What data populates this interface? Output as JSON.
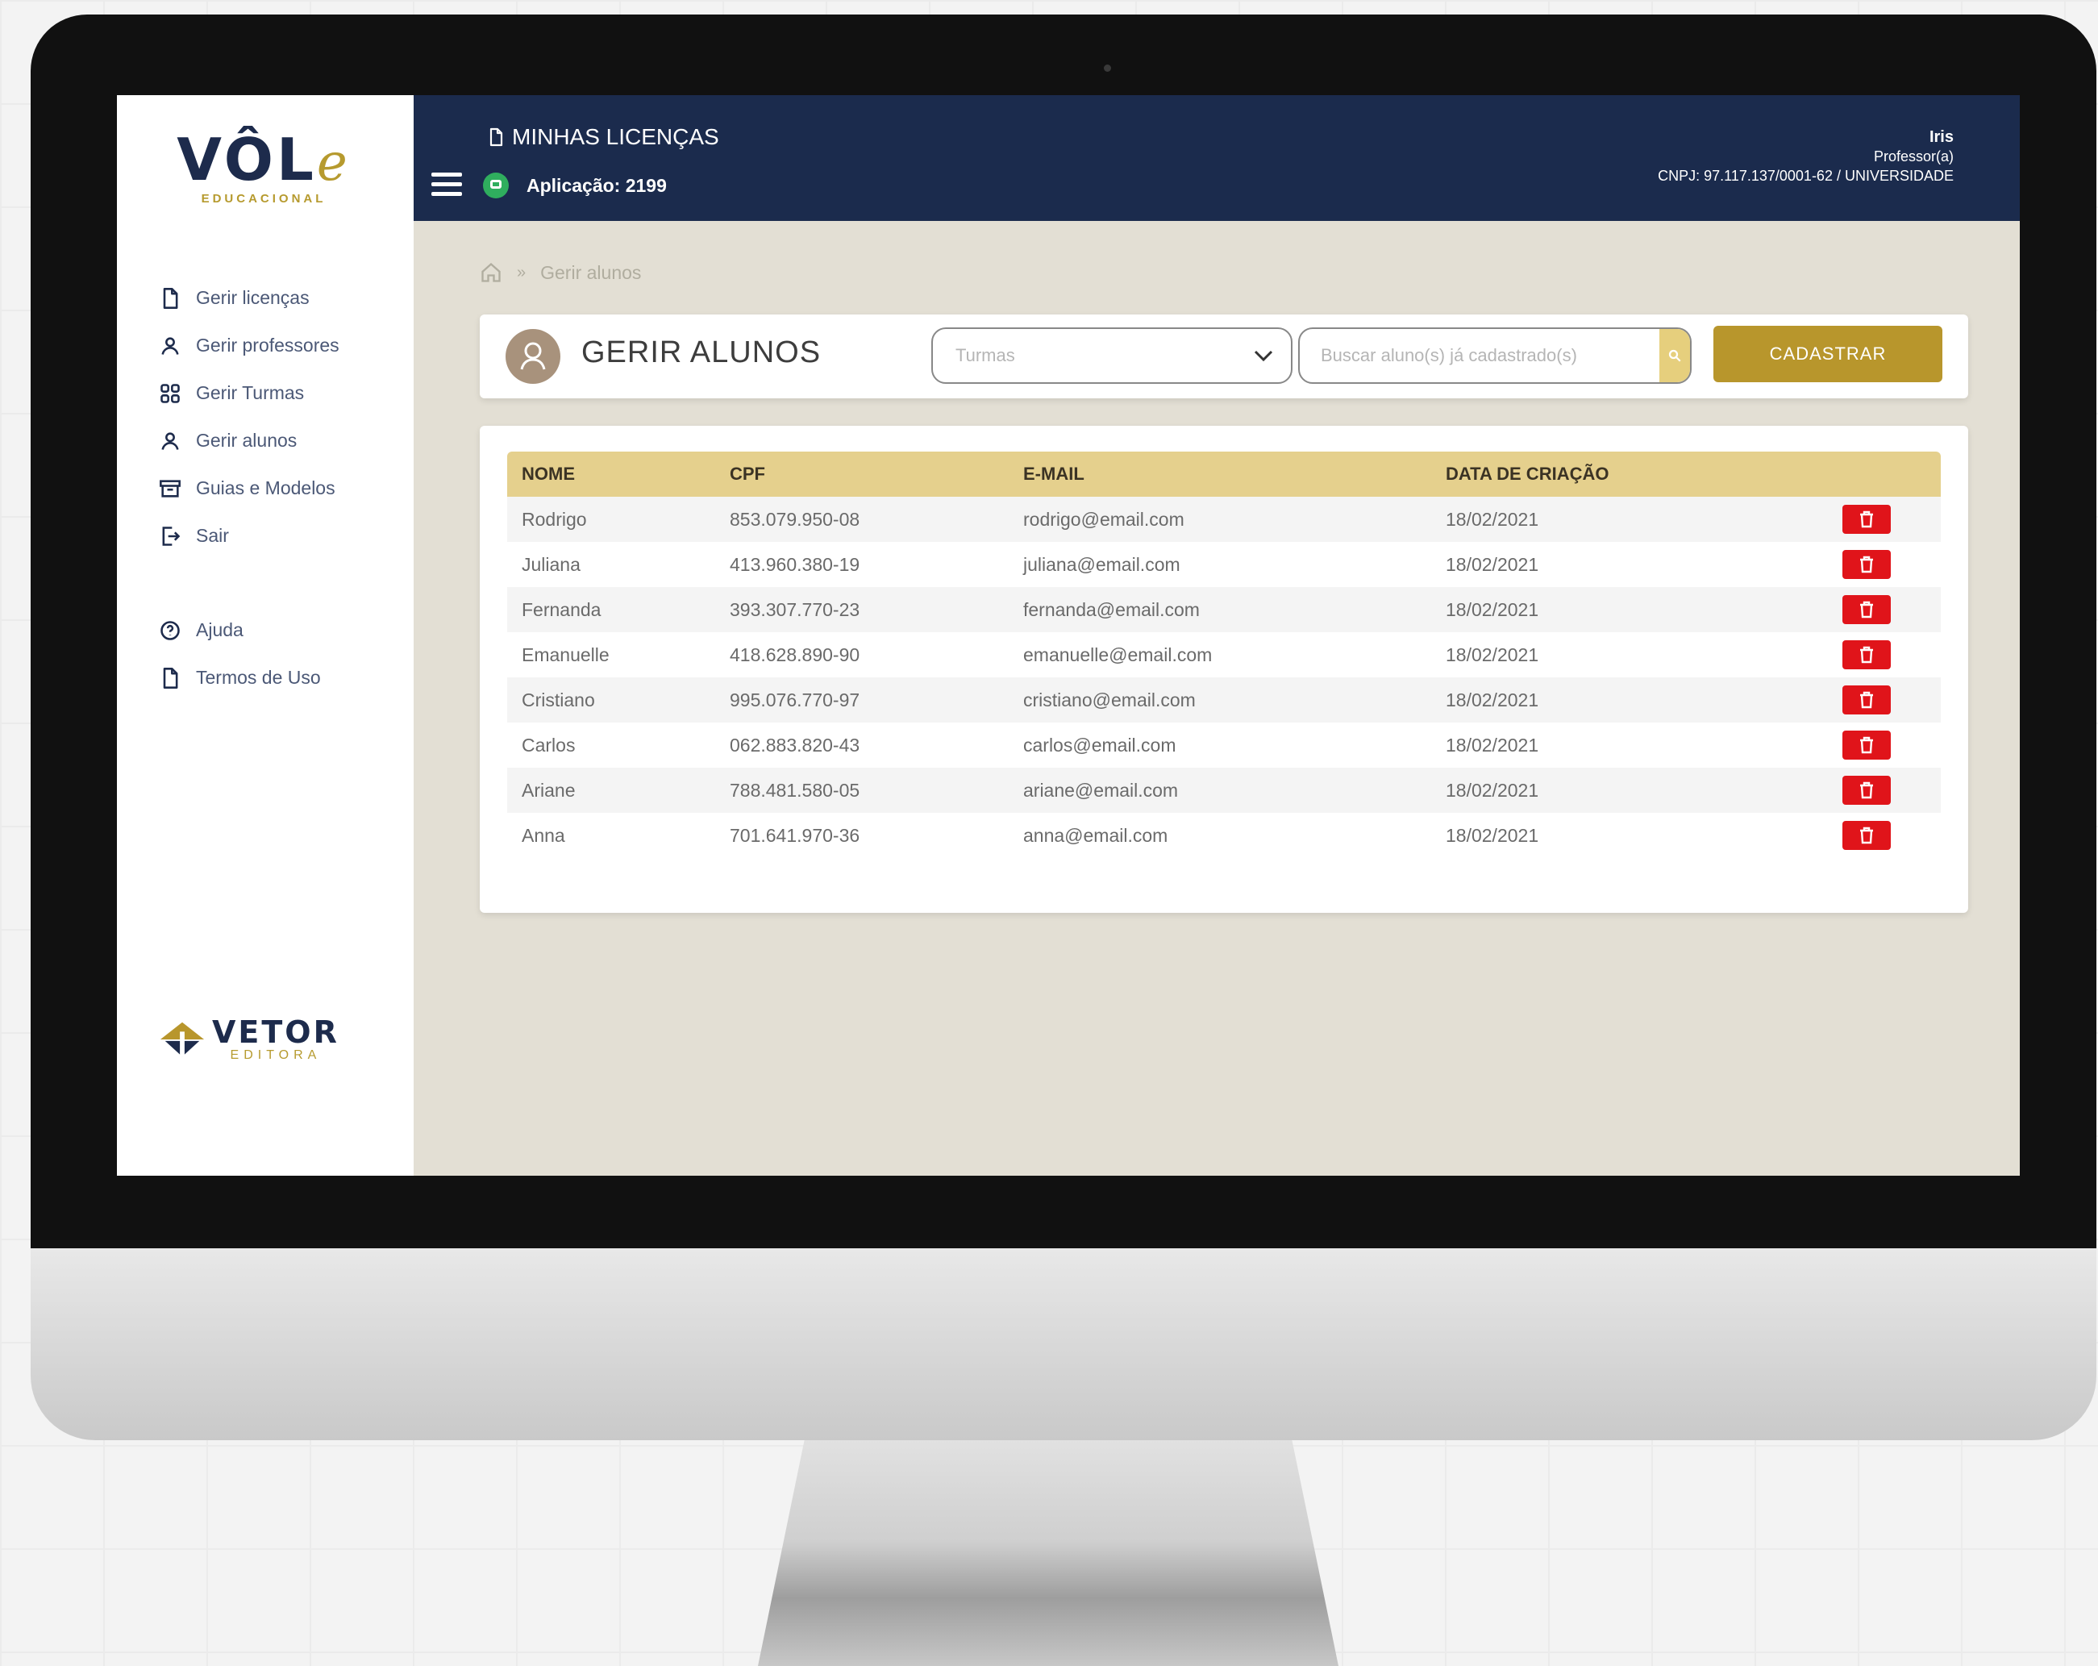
{
  "brand": {
    "logo_text": "VÔL",
    "logo_e": "e",
    "logo_sub": "EDUCACIONAL",
    "publisher": "VETOR",
    "publisher_sub": "EDITORA",
    "accent_color": "#b8962c",
    "navy_color": "#1b2b4d"
  },
  "sidebar": {
    "items": [
      {
        "label": "Gerir licenças",
        "icon": "file-icon"
      },
      {
        "label": "Gerir professores",
        "icon": "user-icon"
      },
      {
        "label": "Gerir Turmas",
        "icon": "grid-icon"
      },
      {
        "label": "Gerir alunos",
        "icon": "user-icon"
      },
      {
        "label": "Guias e Modelos",
        "icon": "box-icon"
      },
      {
        "label": "Sair",
        "icon": "logout-icon"
      }
    ],
    "secondary": [
      {
        "label": "Ajuda",
        "icon": "help-icon"
      },
      {
        "label": "Termos de Uso",
        "icon": "file-icon"
      }
    ]
  },
  "topbar": {
    "title": "MINHAS LICENÇAS",
    "application": "Aplicação: 2199",
    "user_name": "Iris",
    "user_role": "Professor(a)",
    "user_org": "CNPJ: 97.117.137/0001-62 / UNIVERSIDADE"
  },
  "breadcrumb": {
    "current": "Gerir alunos"
  },
  "header": {
    "title": "GERIR ALUNOS",
    "turmas_placeholder": "Turmas",
    "search_placeholder": "Buscar aluno(s) já cadastrado(s)",
    "register_label": "CADASTRAR"
  },
  "table": {
    "columns": [
      "NOME",
      "CPF",
      "E-MAIL",
      "DATA DE CRIAÇÃO"
    ],
    "rows": [
      {
        "nome": "Rodrigo",
        "cpf": "853.079.950-08",
        "email": "rodrigo@email.com",
        "data": "18/02/2021"
      },
      {
        "nome": "Juliana",
        "cpf": "413.960.380-19",
        "email": "juliana@email.com",
        "data": "18/02/2021"
      },
      {
        "nome": "Fernanda",
        "cpf": "393.307.770-23",
        "email": "fernanda@email.com",
        "data": "18/02/2021"
      },
      {
        "nome": "Emanuelle",
        "cpf": "418.628.890-90",
        "email": "emanuelle@email.com",
        "data": "18/02/2021"
      },
      {
        "nome": "Cristiano",
        "cpf": "995.076.770-97",
        "email": "cristiano@email.com",
        "data": "18/02/2021"
      },
      {
        "nome": "Carlos",
        "cpf": "062.883.820-43",
        "email": "carlos@email.com",
        "data": "18/02/2021"
      },
      {
        "nome": "Ariane",
        "cpf": "788.481.580-05",
        "email": "ariane@email.com",
        "data": "18/02/2021"
      },
      {
        "nome": "Anna",
        "cpf": "701.641.970-36",
        "email": "anna@email.com",
        "data": "18/02/2021"
      }
    ]
  }
}
